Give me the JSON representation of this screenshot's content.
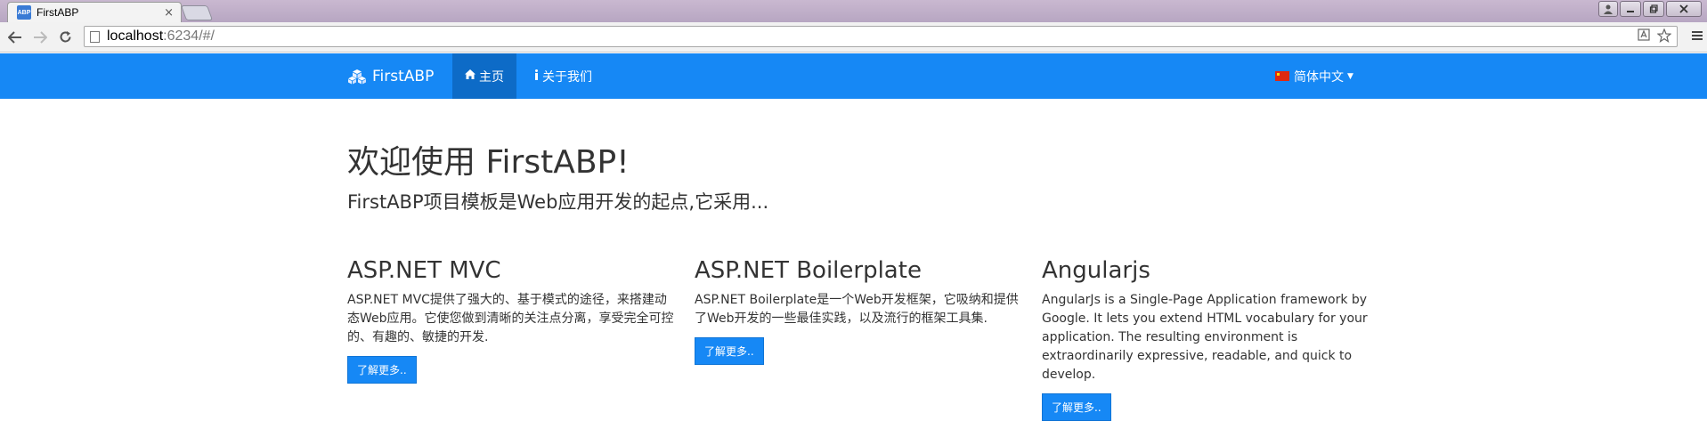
{
  "browser": {
    "tab_title": "FirstABP",
    "favicon_text": "ABP",
    "tab_close": "×",
    "url_host": "localhost",
    "url_rest": ":6234/#/"
  },
  "navbar": {
    "brand": "FirstABP",
    "items": [
      {
        "label": "主页",
        "icon": "home-icon",
        "active": true
      },
      {
        "label": "关于我们",
        "icon": "info-icon",
        "active": false
      }
    ],
    "language": "简体中文",
    "accent_color": "#1688f5"
  },
  "hero": {
    "title": "欢迎使用 FirstABP!",
    "subtitle": "FirstABP项目模板是Web应用开发的起点,它采用..."
  },
  "columns": [
    {
      "title": "ASP.NET MVC",
      "text": "ASP.NET MVC提供了强大的、基于模式的途径，来搭建动态Web应用。它使您做到清晰的关注点分离，享受完全可控的、有趣的、敏捷的开发.",
      "button": "了解更多.."
    },
    {
      "title": "ASP.NET Boilerplate",
      "text": "ASP.NET Boilerplate是一个Web开发框架，它吸纳和提供了Web开发的一些最佳实践，以及流行的框架工具集.",
      "button": "了解更多.."
    },
    {
      "title": "Angularjs",
      "text": "AngularJs is a Single-Page Application framework by Google. It lets you extend HTML vocabulary for your application. The resulting environment is extraordinarily expressive, readable, and quick to develop.",
      "button": "了解更多.."
    }
  ]
}
